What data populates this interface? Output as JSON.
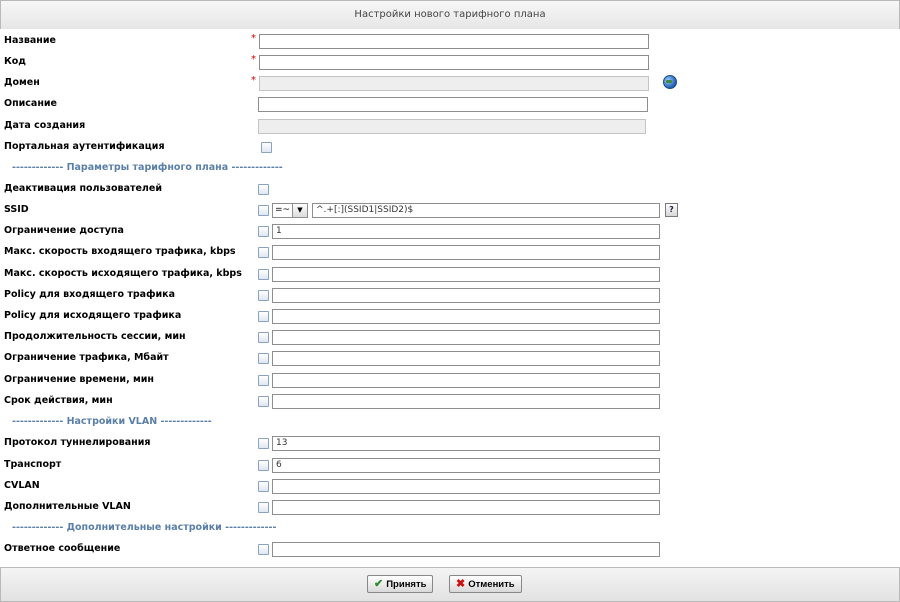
{
  "window": {
    "title": "Настройки нового тарифного плана"
  },
  "fields": {
    "name": {
      "label": "Название",
      "value": ""
    },
    "code": {
      "label": "Код",
      "value": ""
    },
    "domain": {
      "label": "Домен",
      "value": ""
    },
    "description": {
      "label": "Описание",
      "value": ""
    },
    "created": {
      "label": "Дата создания",
      "value": ""
    },
    "portal_auth": {
      "label": "Портальная аутентификация"
    }
  },
  "sections": {
    "plan": "------------- Параметры тарифного плана -------------",
    "vlan": "------------- Настройки VLAN -------------",
    "extra": "------------- Дополнительные настройки -------------"
  },
  "params": {
    "deactivation": {
      "label": "Деактивация пользователей"
    },
    "ssid": {
      "label": "SSID",
      "operator": "=~",
      "value": "^.+[:](SSID1|SSID2)$",
      "help": "?"
    },
    "access": {
      "label": "Ограничение доступа",
      "value": "1"
    },
    "rate_in": {
      "label": "Макс. скорость входящего трафика, kbps",
      "value": ""
    },
    "rate_out": {
      "label": "Макс. скорость исходящего трафика, kbps",
      "value": ""
    },
    "policy_in": {
      "label": "Policy для входящего трафика",
      "value": ""
    },
    "policy_out": {
      "label": "Policy для исходящего трафика",
      "value": ""
    },
    "session": {
      "label": "Продолжительность сессии, мин",
      "value": ""
    },
    "traffic": {
      "label": "Ограничение трафика, Мбайт",
      "value": ""
    },
    "time": {
      "label": "Ограничение времени, мин",
      "value": ""
    },
    "validity": {
      "label": "Срок действия, мин",
      "value": ""
    }
  },
  "vlan": {
    "protocol": {
      "label": "Протокол туннелирования",
      "value": "13"
    },
    "transport": {
      "label": "Транспорт",
      "value": "6"
    },
    "cvlan": {
      "label": "CVLAN",
      "value": ""
    },
    "extra_vlan": {
      "label": "Дополнительные VLAN",
      "value": ""
    }
  },
  "extra": {
    "reply": {
      "label": "Ответное сообщение",
      "value": ""
    }
  },
  "required_mark": "*",
  "buttons": {
    "accept": "Принять",
    "cancel": "Отменить"
  },
  "colors": {
    "section": "#5a7fa8",
    "required": "#cc0000"
  }
}
